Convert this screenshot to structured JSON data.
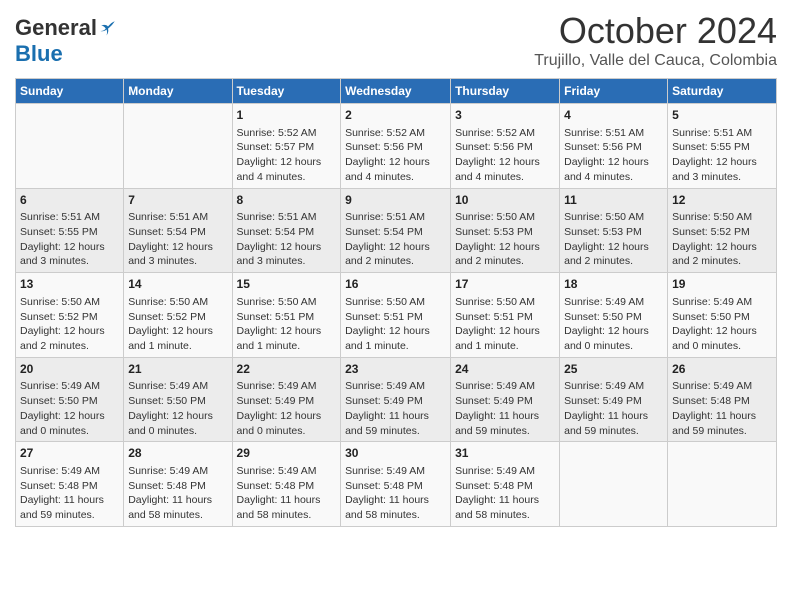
{
  "header": {
    "logo_general": "General",
    "logo_blue": "Blue",
    "month": "October 2024",
    "location": "Trujillo, Valle del Cauca, Colombia"
  },
  "days_of_week": [
    "Sunday",
    "Monday",
    "Tuesday",
    "Wednesday",
    "Thursday",
    "Friday",
    "Saturday"
  ],
  "weeks": [
    [
      {
        "day": "",
        "info": ""
      },
      {
        "day": "",
        "info": ""
      },
      {
        "day": "1",
        "info": "Sunrise: 5:52 AM\nSunset: 5:57 PM\nDaylight: 12 hours and 4 minutes."
      },
      {
        "day": "2",
        "info": "Sunrise: 5:52 AM\nSunset: 5:56 PM\nDaylight: 12 hours and 4 minutes."
      },
      {
        "day": "3",
        "info": "Sunrise: 5:52 AM\nSunset: 5:56 PM\nDaylight: 12 hours and 4 minutes."
      },
      {
        "day": "4",
        "info": "Sunrise: 5:51 AM\nSunset: 5:56 PM\nDaylight: 12 hours and 4 minutes."
      },
      {
        "day": "5",
        "info": "Sunrise: 5:51 AM\nSunset: 5:55 PM\nDaylight: 12 hours and 3 minutes."
      }
    ],
    [
      {
        "day": "6",
        "info": "Sunrise: 5:51 AM\nSunset: 5:55 PM\nDaylight: 12 hours and 3 minutes."
      },
      {
        "day": "7",
        "info": "Sunrise: 5:51 AM\nSunset: 5:54 PM\nDaylight: 12 hours and 3 minutes."
      },
      {
        "day": "8",
        "info": "Sunrise: 5:51 AM\nSunset: 5:54 PM\nDaylight: 12 hours and 3 minutes."
      },
      {
        "day": "9",
        "info": "Sunrise: 5:51 AM\nSunset: 5:54 PM\nDaylight: 12 hours and 2 minutes."
      },
      {
        "day": "10",
        "info": "Sunrise: 5:50 AM\nSunset: 5:53 PM\nDaylight: 12 hours and 2 minutes."
      },
      {
        "day": "11",
        "info": "Sunrise: 5:50 AM\nSunset: 5:53 PM\nDaylight: 12 hours and 2 minutes."
      },
      {
        "day": "12",
        "info": "Sunrise: 5:50 AM\nSunset: 5:52 PM\nDaylight: 12 hours and 2 minutes."
      }
    ],
    [
      {
        "day": "13",
        "info": "Sunrise: 5:50 AM\nSunset: 5:52 PM\nDaylight: 12 hours and 2 minutes."
      },
      {
        "day": "14",
        "info": "Sunrise: 5:50 AM\nSunset: 5:52 PM\nDaylight: 12 hours and 1 minute."
      },
      {
        "day": "15",
        "info": "Sunrise: 5:50 AM\nSunset: 5:51 PM\nDaylight: 12 hours and 1 minute."
      },
      {
        "day": "16",
        "info": "Sunrise: 5:50 AM\nSunset: 5:51 PM\nDaylight: 12 hours and 1 minute."
      },
      {
        "day": "17",
        "info": "Sunrise: 5:50 AM\nSunset: 5:51 PM\nDaylight: 12 hours and 1 minute."
      },
      {
        "day": "18",
        "info": "Sunrise: 5:49 AM\nSunset: 5:50 PM\nDaylight: 12 hours and 0 minutes."
      },
      {
        "day": "19",
        "info": "Sunrise: 5:49 AM\nSunset: 5:50 PM\nDaylight: 12 hours and 0 minutes."
      }
    ],
    [
      {
        "day": "20",
        "info": "Sunrise: 5:49 AM\nSunset: 5:50 PM\nDaylight: 12 hours and 0 minutes."
      },
      {
        "day": "21",
        "info": "Sunrise: 5:49 AM\nSunset: 5:50 PM\nDaylight: 12 hours and 0 minutes."
      },
      {
        "day": "22",
        "info": "Sunrise: 5:49 AM\nSunset: 5:49 PM\nDaylight: 12 hours and 0 minutes."
      },
      {
        "day": "23",
        "info": "Sunrise: 5:49 AM\nSunset: 5:49 PM\nDaylight: 11 hours and 59 minutes."
      },
      {
        "day": "24",
        "info": "Sunrise: 5:49 AM\nSunset: 5:49 PM\nDaylight: 11 hours and 59 minutes."
      },
      {
        "day": "25",
        "info": "Sunrise: 5:49 AM\nSunset: 5:49 PM\nDaylight: 11 hours and 59 minutes."
      },
      {
        "day": "26",
        "info": "Sunrise: 5:49 AM\nSunset: 5:48 PM\nDaylight: 11 hours and 59 minutes."
      }
    ],
    [
      {
        "day": "27",
        "info": "Sunrise: 5:49 AM\nSunset: 5:48 PM\nDaylight: 11 hours and 59 minutes."
      },
      {
        "day": "28",
        "info": "Sunrise: 5:49 AM\nSunset: 5:48 PM\nDaylight: 11 hours and 58 minutes."
      },
      {
        "day": "29",
        "info": "Sunrise: 5:49 AM\nSunset: 5:48 PM\nDaylight: 11 hours and 58 minutes."
      },
      {
        "day": "30",
        "info": "Sunrise: 5:49 AM\nSunset: 5:48 PM\nDaylight: 11 hours and 58 minutes."
      },
      {
        "day": "31",
        "info": "Sunrise: 5:49 AM\nSunset: 5:48 PM\nDaylight: 11 hours and 58 minutes."
      },
      {
        "day": "",
        "info": ""
      },
      {
        "day": "",
        "info": ""
      }
    ]
  ]
}
